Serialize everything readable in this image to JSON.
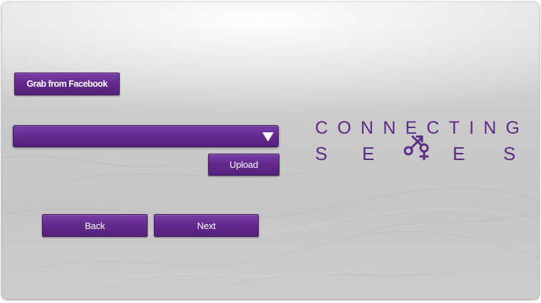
{
  "buttons": {
    "facebook": "Grab from Facebook",
    "upload": "Upload",
    "back": "Back",
    "next": "Next"
  },
  "photo_select": {
    "selected_value": ""
  },
  "logo": {
    "line1": "CONNECTING",
    "line2": "SEXES"
  },
  "colors": {
    "button_purple": "#642a8e",
    "logo_purple": "#5b2a86",
    "background": "#c9c9c9"
  }
}
